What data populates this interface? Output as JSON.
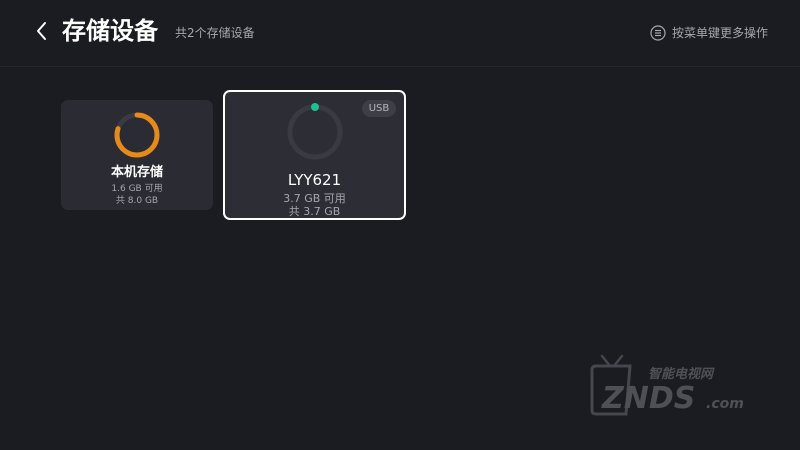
{
  "header": {
    "title": "存储设备",
    "subtitle": "共2个存储设备",
    "menu_hint": "按菜单键更多操作",
    "back_icon": "chevron-left-icon",
    "menu_icon": "menu-circle-icon"
  },
  "devices": [
    {
      "name": "本机存储",
      "available": "1.6 GB 可用",
      "total": "共 8.0 GB",
      "available_fraction": 0.2,
      "ring_color": "#e68a1c",
      "focused": false
    },
    {
      "name": "LYY621",
      "available": "3.7 GB 可用",
      "total": "共 3.7 GB",
      "badge": "USB",
      "available_fraction": 1.0,
      "ring_color": "#3a3a42",
      "indicator_color": "#1fbf8f",
      "focused": true
    }
  ],
  "watermark": {
    "top_text": "智能电视网",
    "main_text": "ZNDS",
    "suffix": ".com"
  },
  "colors": {
    "background": "#1b1b22",
    "card": "#2b2b33",
    "accent_orange": "#e68a1c",
    "accent_green": "#1fbf8f",
    "muted_text": "#a6a6ad"
  }
}
